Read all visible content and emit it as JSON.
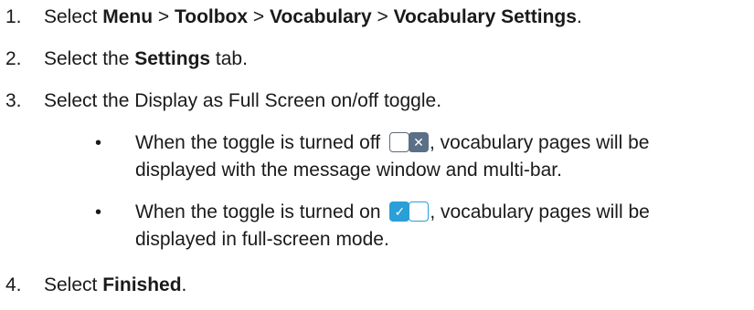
{
  "steps": [
    {
      "number": "1.",
      "prefix": "Select ",
      "b1": "Menu",
      "sep1": " > ",
      "b2": "Toolbox",
      "sep2": " > ",
      "b3": "Vocabulary",
      "sep3": " > ",
      "b4": "Vocabulary Settings",
      "suffix": "."
    },
    {
      "number": "2.",
      "prefix": "Select the ",
      "b1": "Settings",
      "suffix": " tab."
    },
    {
      "number": "3.",
      "text": "Select the Display as Full Screen on/off toggle."
    },
    {
      "number": "4.",
      "prefix": "Select ",
      "b1": "Finished",
      "suffix": "."
    }
  ],
  "bullets": [
    {
      "symbol": "•",
      "line1_before": "When the toggle is turned off ",
      "line1_after": ", vocabulary pages will be",
      "line2": "displayed with the message window and multi-bar.",
      "icon": "toggle-off-icon",
      "icon_glyph": "✕"
    },
    {
      "symbol": "•",
      "line1_before": "When the toggle is turned on ",
      "line1_after": ", vocabulary pages will be",
      "line2": "displayed in full-screen mode.",
      "icon": "toggle-on-icon",
      "icon_glyph": "✓"
    }
  ],
  "colors": {
    "toggle_off": "#5b6f86",
    "toggle_on": "#2a9fd8",
    "text": "#1a1a1a"
  }
}
